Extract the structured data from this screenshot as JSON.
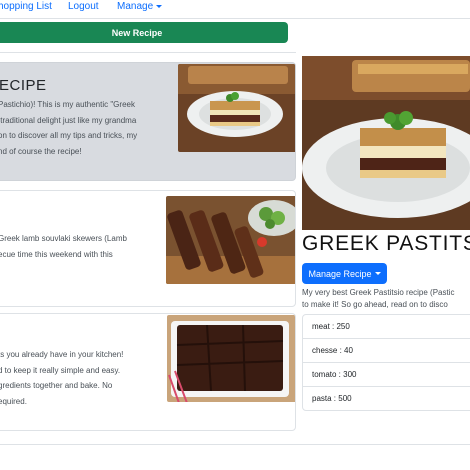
{
  "nav": {
    "shopping_list": "hopping List",
    "logout": "Logout",
    "manage": "Manage"
  },
  "new_recipe_label": "New Recipe",
  "recipes": [
    {
      "title": "ECIPE",
      "text": "Pastichio)! This is my authentic \"Greek\n traditional delight just like my grandma\non to discover all my tips and tricks, my\nnd of course the recipe!"
    },
    {
      "text": "Greek lamb souvlaki skewers (Lamb\necue time this weekend with this"
    },
    {
      "text": "ts you already have in your kitchen!\nd to keep it really simple and easy.\ngredients together and bake. No\nequired."
    }
  ],
  "detail": {
    "title": "GREEK PASTITSI",
    "manage_label": "Manage Recipe",
    "description": "My very best Greek Pastitsio recipe (Pastic\nto make it! So go ahead, read on to disco",
    "ingredients": [
      "meat : 250",
      "chesse : 40",
      "tomato : 300",
      "pasta : 500"
    ]
  }
}
